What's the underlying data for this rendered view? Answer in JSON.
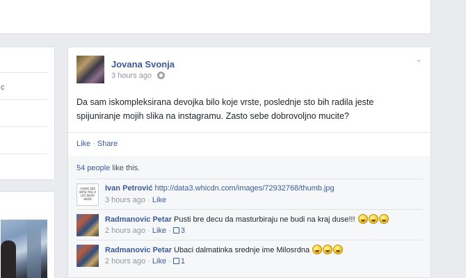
{
  "left_column": {
    "fragment_text": "c"
  },
  "post": {
    "author": "Jovana Svonja",
    "time": "3 hours ago",
    "text": "Da sam iskompleksirana devojka bilo koje vrste, poslednje sto bih radila jeste spijuniranje mojih slika na instagramu. Zasto sebe dobrovoljno mucite?",
    "actions": {
      "like": "Like",
      "sep": "·",
      "share": "Share"
    },
    "likes": {
      "count": "54 people",
      "tail": "like this."
    },
    "comments": [
      {
        "author": "Ivan Petrović",
        "text": "http://data3.whicdn.com/images/72932768/thumb.jpg",
        "text_is_link": true,
        "avatar_text": "I HAVE SEX WITH YOU A LOT IN MY HEAD",
        "time": "3 hours ago",
        "like": "Like",
        "like_count": "",
        "emoticons": 0
      },
      {
        "author": "Radmanovic Petar",
        "text": "Pusti bre decu da masturbiraju ne budi na kraj duse!!!",
        "text_is_link": false,
        "time": "2 hours ago",
        "like": "Like",
        "like_count": "3",
        "emoticons": 3
      },
      {
        "author": "Radmanovic Petar",
        "text": "Ubaci dalmatinka srednje ime Milosrdna",
        "text_is_link": false,
        "time": "2 hours ago",
        "like": "Like",
        "like_count": "1",
        "emoticons": 3
      }
    ]
  }
}
